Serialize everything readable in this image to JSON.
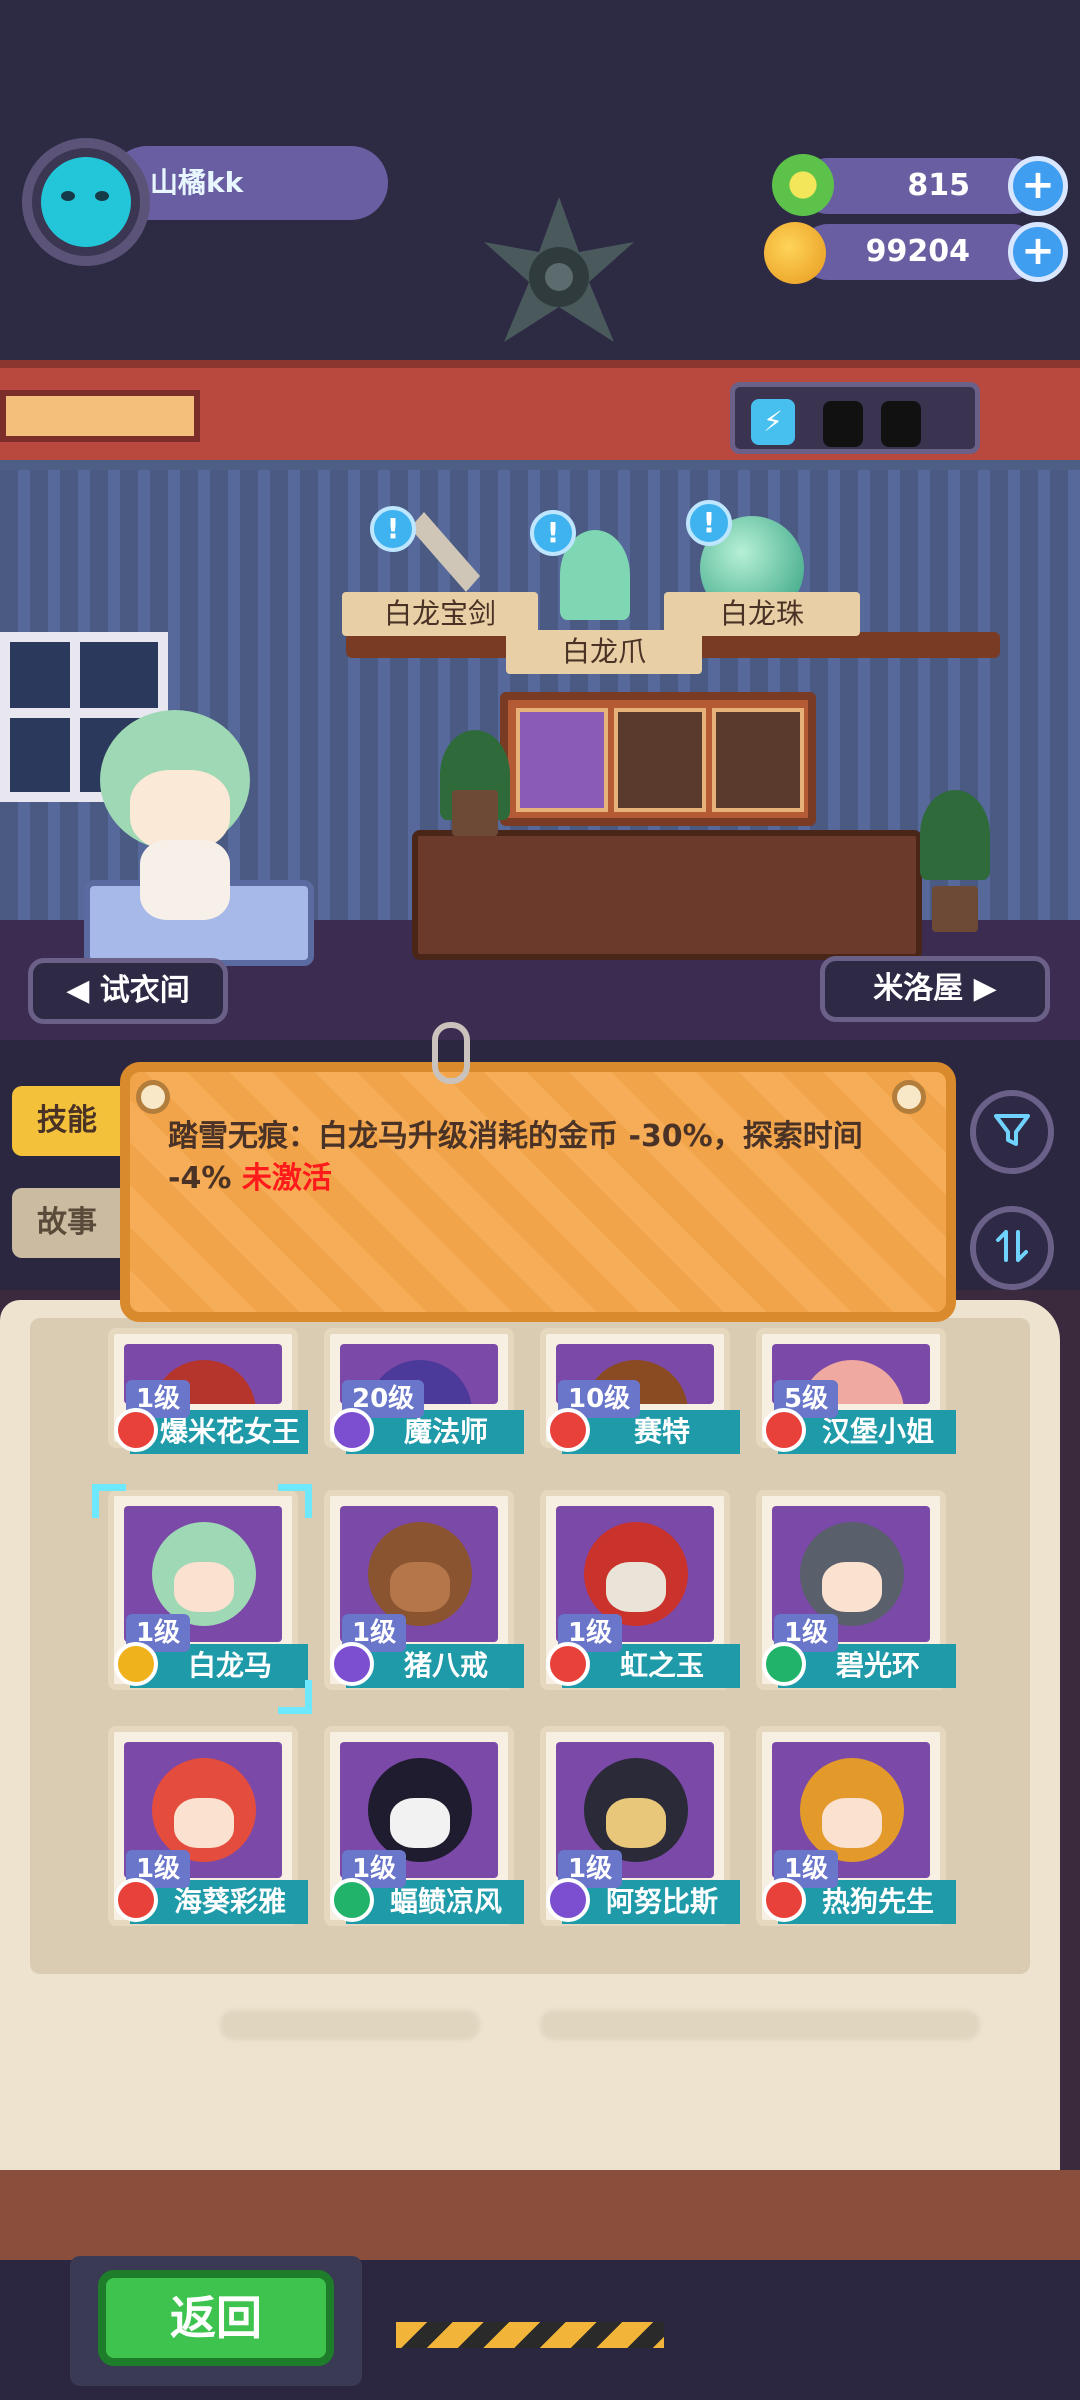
{
  "player": {
    "name": "山橘kk"
  },
  "resources": {
    "gems": "815",
    "coins": "99204"
  },
  "display_items": [
    {
      "label": "白龙宝剑"
    },
    {
      "label": "白龙爪"
    },
    {
      "label": "白龙珠"
    }
  ],
  "nav": {
    "left": "◀ 试衣间",
    "right": "米洛屋 ▶"
  },
  "tabs": {
    "skill": "技能",
    "story": "故事"
  },
  "skill": {
    "text": "踏雪无痕：白龙马升级消耗的金币 -30%，探索时间 -4%",
    "status": "未激活"
  },
  "cards": [
    {
      "level": "1级",
      "name": "爆米花女王",
      "badge": "red"
    },
    {
      "level": "20级",
      "name": "魔法师",
      "badge": "purple"
    },
    {
      "level": "10级",
      "name": "赛特",
      "badge": "red"
    },
    {
      "level": "5级",
      "name": "汉堡小姐",
      "badge": "red"
    },
    {
      "level": "1级",
      "name": "白龙马",
      "badge": "gold"
    },
    {
      "level": "1级",
      "name": "猪八戒",
      "badge": "purple"
    },
    {
      "level": "1级",
      "name": "虹之玉",
      "badge": "red"
    },
    {
      "level": "1级",
      "name": "碧光环",
      "badge": "green"
    },
    {
      "level": "1级",
      "name": "海葵彩雅",
      "badge": "red"
    },
    {
      "level": "1级",
      "name": "蝠鲼凉风",
      "badge": "green"
    },
    {
      "level": "1级",
      "name": "阿努比斯",
      "badge": "purple"
    },
    {
      "level": "1级",
      "name": "热狗先生",
      "badge": "red"
    }
  ],
  "buttons": {
    "back": "返回",
    "filter_icon": "filter-icon",
    "sort_icon": "sort-icon"
  },
  "colors": {
    "badge_red": "#e8413a",
    "badge_purple": "#7b4fd0",
    "badge_gold": "#f0b21c",
    "badge_green": "#22b36a",
    "accent_teal": "#1f9aa8"
  }
}
